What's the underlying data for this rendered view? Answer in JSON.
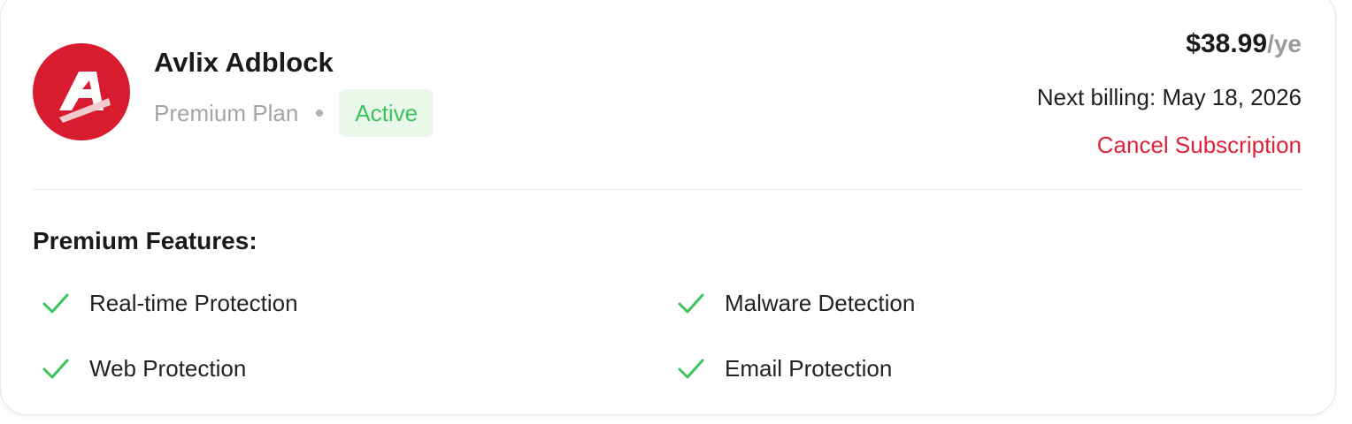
{
  "app": {
    "name": "Avlix Adblock",
    "plan": "Premium Plan",
    "status": "Active",
    "logo_icon": "avlix-logo-icon",
    "brand_color": "#d81b2e"
  },
  "billing": {
    "price": "$38.99",
    "period": "/ye",
    "next_billing": "Next billing: May 18, 2026",
    "cancel_label": "Cancel Subscription",
    "cancel_color": "#e0213a"
  },
  "features": {
    "title": "Premium Features:",
    "check_icon": "check-icon",
    "check_color": "#3cc45b",
    "items": [
      {
        "label": "Real-time Protection"
      },
      {
        "label": "Malware Detection"
      },
      {
        "label": "Web Protection"
      },
      {
        "label": "Email Protection"
      }
    ]
  }
}
